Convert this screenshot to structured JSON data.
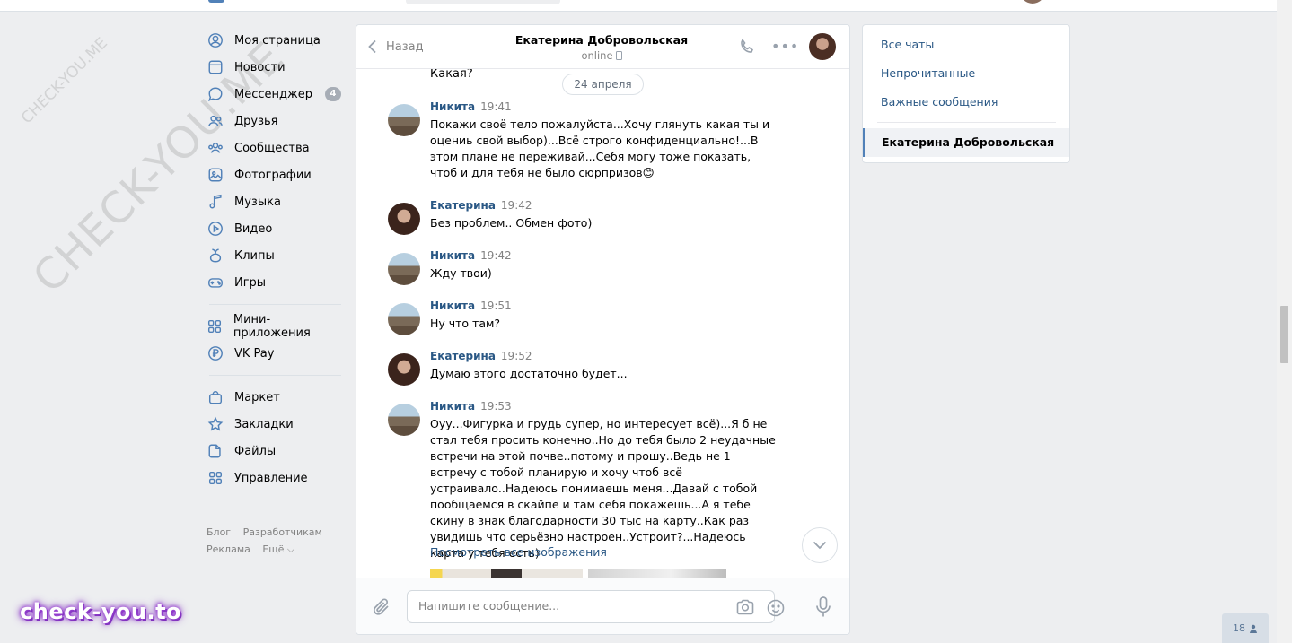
{
  "watermark": {
    "small": "CHECK-YOU.ME",
    "big": "CHECK-YOU.ME"
  },
  "nav": {
    "items": [
      {
        "label": "Моя страница",
        "icon": "user-circle-icon"
      },
      {
        "label": "Новости",
        "icon": "newspaper-icon"
      },
      {
        "label": "Мессенджер",
        "icon": "chat-bubble-icon",
        "counter": "4"
      },
      {
        "label": "Друзья",
        "icon": "friends-icon"
      },
      {
        "label": "Сообщества",
        "icon": "communities-icon"
      },
      {
        "label": "Фотографии",
        "icon": "photo-icon"
      },
      {
        "label": "Музыка",
        "icon": "music-note-icon"
      },
      {
        "label": "Видео",
        "icon": "play-icon"
      },
      {
        "label": "Клипы",
        "icon": "clips-icon"
      },
      {
        "label": "Игры",
        "icon": "gamepad-icon"
      }
    ],
    "items2": [
      {
        "label": "Мини-приложения",
        "icon": "apps-grid-icon"
      },
      {
        "label": "VK Pay",
        "icon": "ruble-coin-icon"
      }
    ],
    "items3": [
      {
        "label": "Маркет",
        "icon": "shopping-bag-icon"
      },
      {
        "label": "Закладки",
        "icon": "star-icon"
      },
      {
        "label": "Файлы",
        "icon": "file-icon"
      },
      {
        "label": "Управление",
        "icon": "apps-grid-icon"
      }
    ],
    "footer": {
      "blog": "Блог",
      "developers": "Разработчикам",
      "ads": "Реклама",
      "more": "Ещё ⌵"
    }
  },
  "chat": {
    "back_label": "Назад",
    "title": "Екатерина Добровольская",
    "status": "online",
    "prev_text": "Какая?",
    "date_pill": "24 апреля",
    "messages": [
      {
        "author": "Никита",
        "time": "19:41",
        "avatar": "nikita",
        "text": "Покажи своё тело пожалуйста...Хочу глянуть какая ты и оцениь свой выбор)...Всё строго конфиденциально!...В этом плане не переживай...Себя могу тоже показать, чтоб и для тебя не было сюрпризов😊"
      },
      {
        "author": "Екатерина",
        "time": "19:42",
        "avatar": "ekaterina",
        "text": "Без проблем.. Обмен фото)"
      },
      {
        "author": "Никита",
        "time": "19:42",
        "avatar": "nikita",
        "text": "Жду твои)"
      },
      {
        "author": "Никита",
        "time": "19:51",
        "avatar": "nikita",
        "text": "Ну что там?"
      },
      {
        "author": "Екатерина",
        "time": "19:52",
        "avatar": "ekaterina",
        "text": "Думаю этого достаточно будет..."
      },
      {
        "author": "Никита",
        "time": "19:53",
        "avatar": "nikita",
        "text": "Оуу...Фигурка и грудь супер, но интересует всё)...Я б не стал тебя просить конечно..Но до тебя было 2 неудачные встречи на этой почве..потому и прошу..Ведь не 1 встречу с тобой планирую и хочу чтоб всё устраивало..Надеюсь понимаешь меня...Давай с тобой пообщаемся в скайпе и там себя покажешь...А я тебе скину в знак благодарности 30 тыс на карту..Как раз увидишь что серьёзно настроен..Устроит?...Надеюсь карта у тебя есть)"
      }
    ],
    "view_all_images": "Посмотреть все изображения",
    "composer_placeholder": "Напишите сообщение..."
  },
  "filters": {
    "all": "Все чаты",
    "unread": "Непрочитанные",
    "important": "Важные сообщения",
    "active_chat": "Екатерина Добровольская"
  },
  "online_count": "18",
  "brand_mark": "check-you.to",
  "colors": {
    "accent": "#5181b8",
    "link": "#2a5885",
    "page_bg": "#edeef0",
    "brand_glow": "#9b44d4"
  }
}
